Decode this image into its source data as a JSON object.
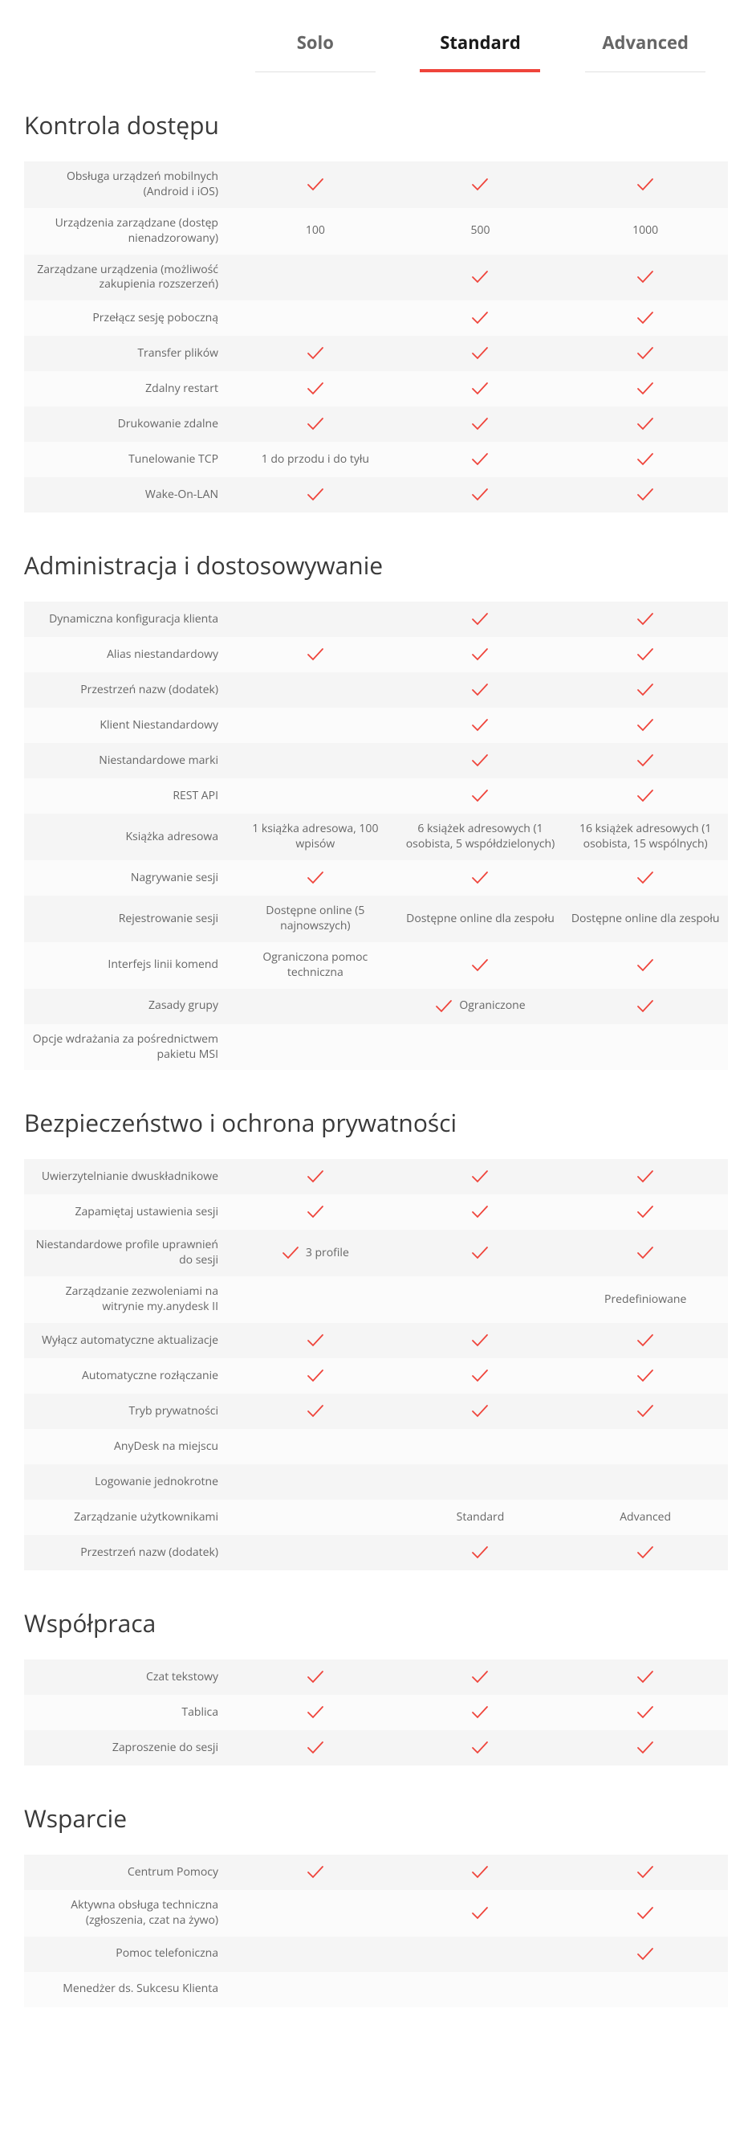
{
  "tabs": {
    "solo": "Solo",
    "standard": "Standard",
    "advanced": "Advanced",
    "activeIndex": 1
  },
  "sections": [
    {
      "title": "Kontrola dostępu",
      "rows": [
        {
          "label": "Obsługa urządzeń mobilnych (Android i iOS)",
          "cells": [
            {
              "check": true
            },
            {
              "check": true
            },
            {
              "check": true
            }
          ]
        },
        {
          "label": "Urządzenia zarządzane (dostęp nienadzorowany)",
          "cells": [
            {
              "text": "100"
            },
            {
              "text": "500"
            },
            {
              "text": "1000"
            }
          ]
        },
        {
          "label": "Zarządzane urządzenia (możliwość zakupienia rozszerzeń)",
          "cells": [
            {},
            {
              "check": true
            },
            {
              "check": true
            }
          ]
        },
        {
          "label": "Przełącz sesję poboczną",
          "cells": [
            {},
            {
              "check": true
            },
            {
              "check": true
            }
          ]
        },
        {
          "label": "Transfer plików",
          "cells": [
            {
              "check": true
            },
            {
              "check": true
            },
            {
              "check": true
            }
          ]
        },
        {
          "label": "Zdalny restart",
          "cells": [
            {
              "check": true
            },
            {
              "check": true
            },
            {
              "check": true
            }
          ]
        },
        {
          "label": "Drukowanie zdalne",
          "cells": [
            {
              "check": true
            },
            {
              "check": true
            },
            {
              "check": true
            }
          ]
        },
        {
          "label": "Tunelowanie TCP",
          "cells": [
            {
              "text": "1 do przodu i do tyłu"
            },
            {
              "check": true
            },
            {
              "check": true
            }
          ]
        },
        {
          "label": "Wake-On-LAN",
          "cells": [
            {
              "check": true
            },
            {
              "check": true
            },
            {
              "check": true
            }
          ]
        }
      ]
    },
    {
      "title": "Administracja i dostosowywanie",
      "rows": [
        {
          "label": "Dynamiczna konfiguracja klienta",
          "cells": [
            {},
            {
              "check": true
            },
            {
              "check": true
            }
          ]
        },
        {
          "label": "Alias niestandardowy",
          "cells": [
            {
              "check": true
            },
            {
              "check": true
            },
            {
              "check": true
            }
          ]
        },
        {
          "label": "Przestrzeń nazw (dodatek)",
          "cells": [
            {},
            {
              "check": true
            },
            {
              "check": true
            }
          ]
        },
        {
          "label": "Klient Niestandardowy",
          "cells": [
            {},
            {
              "check": true
            },
            {
              "check": true
            }
          ]
        },
        {
          "label": "Niestandardowe marki",
          "cells": [
            {},
            {
              "check": true
            },
            {
              "check": true
            }
          ]
        },
        {
          "label": "REST API",
          "cells": [
            {},
            {
              "check": true
            },
            {
              "check": true
            }
          ]
        },
        {
          "label": "Książka adresowa",
          "cells": [
            {
              "text": "1 książka adresowa, 100 wpisów"
            },
            {
              "text": "6 książek adresowych (1 osobista, 5 współdzielonych)"
            },
            {
              "text": "16 książek adresowych (1 osobista, 15 wspólnych)"
            }
          ]
        },
        {
          "label": "Nagrywanie sesji",
          "cells": [
            {
              "check": true
            },
            {
              "check": true
            },
            {
              "check": true
            }
          ]
        },
        {
          "label": "Rejestrowanie sesji",
          "cells": [
            {
              "text": "Dostępne online (5 najnowszych)"
            },
            {
              "text": "Dostępne online dla zespołu"
            },
            {
              "text": "Dostępne online dla zespołu"
            }
          ]
        },
        {
          "label": "Interfejs linii komend",
          "cells": [
            {
              "text": "Ograniczona pomoc techniczna"
            },
            {
              "check": true
            },
            {
              "check": true
            }
          ]
        },
        {
          "label": "Zasady grupy",
          "cells": [
            {},
            {
              "check": true,
              "text": "Ograniczone"
            },
            {
              "check": true
            }
          ]
        },
        {
          "label": "Opcje wdrażania za pośrednictwem pakietu MSI",
          "cells": [
            {},
            {},
            {}
          ]
        }
      ]
    },
    {
      "title": "Bezpieczeństwo i ochrona prywatności",
      "rows": [
        {
          "label": "Uwierzytelnianie dwuskładnikowe",
          "cells": [
            {
              "check": true
            },
            {
              "check": true
            },
            {
              "check": true
            }
          ]
        },
        {
          "label": "Zapamiętaj ustawienia sesji",
          "cells": [
            {
              "check": true
            },
            {
              "check": true
            },
            {
              "check": true
            }
          ]
        },
        {
          "label": "Niestandardowe profile uprawnień do sesji",
          "cells": [
            {
              "check": true,
              "text": "3 profile"
            },
            {
              "check": true
            },
            {
              "check": true
            }
          ]
        },
        {
          "label": "Zarządzanie zezwoleniami na witrynie my.anydesk II",
          "cells": [
            {},
            {},
            {
              "text": "Predefiniowane"
            }
          ]
        },
        {
          "label": "Wyłącz automatyczne aktualizacje",
          "cells": [
            {
              "check": true
            },
            {
              "check": true
            },
            {
              "check": true
            }
          ]
        },
        {
          "label": "Automatyczne rozłączanie",
          "cells": [
            {
              "check": true
            },
            {
              "check": true
            },
            {
              "check": true
            }
          ]
        },
        {
          "label": "Tryb prywatności",
          "cells": [
            {
              "check": true
            },
            {
              "check": true
            },
            {
              "check": true
            }
          ]
        },
        {
          "label": "AnyDesk na miejscu",
          "cells": [
            {},
            {},
            {}
          ]
        },
        {
          "label": "Logowanie jednokrotne",
          "cells": [
            {},
            {},
            {}
          ]
        },
        {
          "label": "Zarządzanie użytkownikami",
          "cells": [
            {},
            {
              "text": "Standard"
            },
            {
              "text": "Advanced"
            }
          ]
        },
        {
          "label": "Przestrzeń nazw (dodatek)",
          "cells": [
            {},
            {
              "check": true
            },
            {
              "check": true
            }
          ]
        }
      ]
    },
    {
      "title": "Współpraca",
      "rows": [
        {
          "label": "Czat tekstowy",
          "cells": [
            {
              "check": true
            },
            {
              "check": true
            },
            {
              "check": true
            }
          ]
        },
        {
          "label": "Tablica",
          "cells": [
            {
              "check": true
            },
            {
              "check": true
            },
            {
              "check": true
            }
          ]
        },
        {
          "label": "Zaproszenie do sesji",
          "cells": [
            {
              "check": true
            },
            {
              "check": true
            },
            {
              "check": true
            }
          ]
        }
      ]
    },
    {
      "title": "Wsparcie",
      "rows": [
        {
          "label": "Centrum Pomocy",
          "cells": [
            {
              "check": true
            },
            {
              "check": true
            },
            {
              "check": true
            }
          ]
        },
        {
          "label": "Aktywna obsługa techniczna (zgłoszenia, czat na żywo)",
          "cells": [
            {},
            {
              "check": true
            },
            {
              "check": true
            }
          ]
        },
        {
          "label": "Pomoc telefoniczna",
          "cells": [
            {},
            {},
            {
              "check": true
            }
          ]
        },
        {
          "label": "Menedżer ds. Sukcesu Klienta",
          "cells": [
            {},
            {},
            {}
          ]
        }
      ]
    }
  ]
}
